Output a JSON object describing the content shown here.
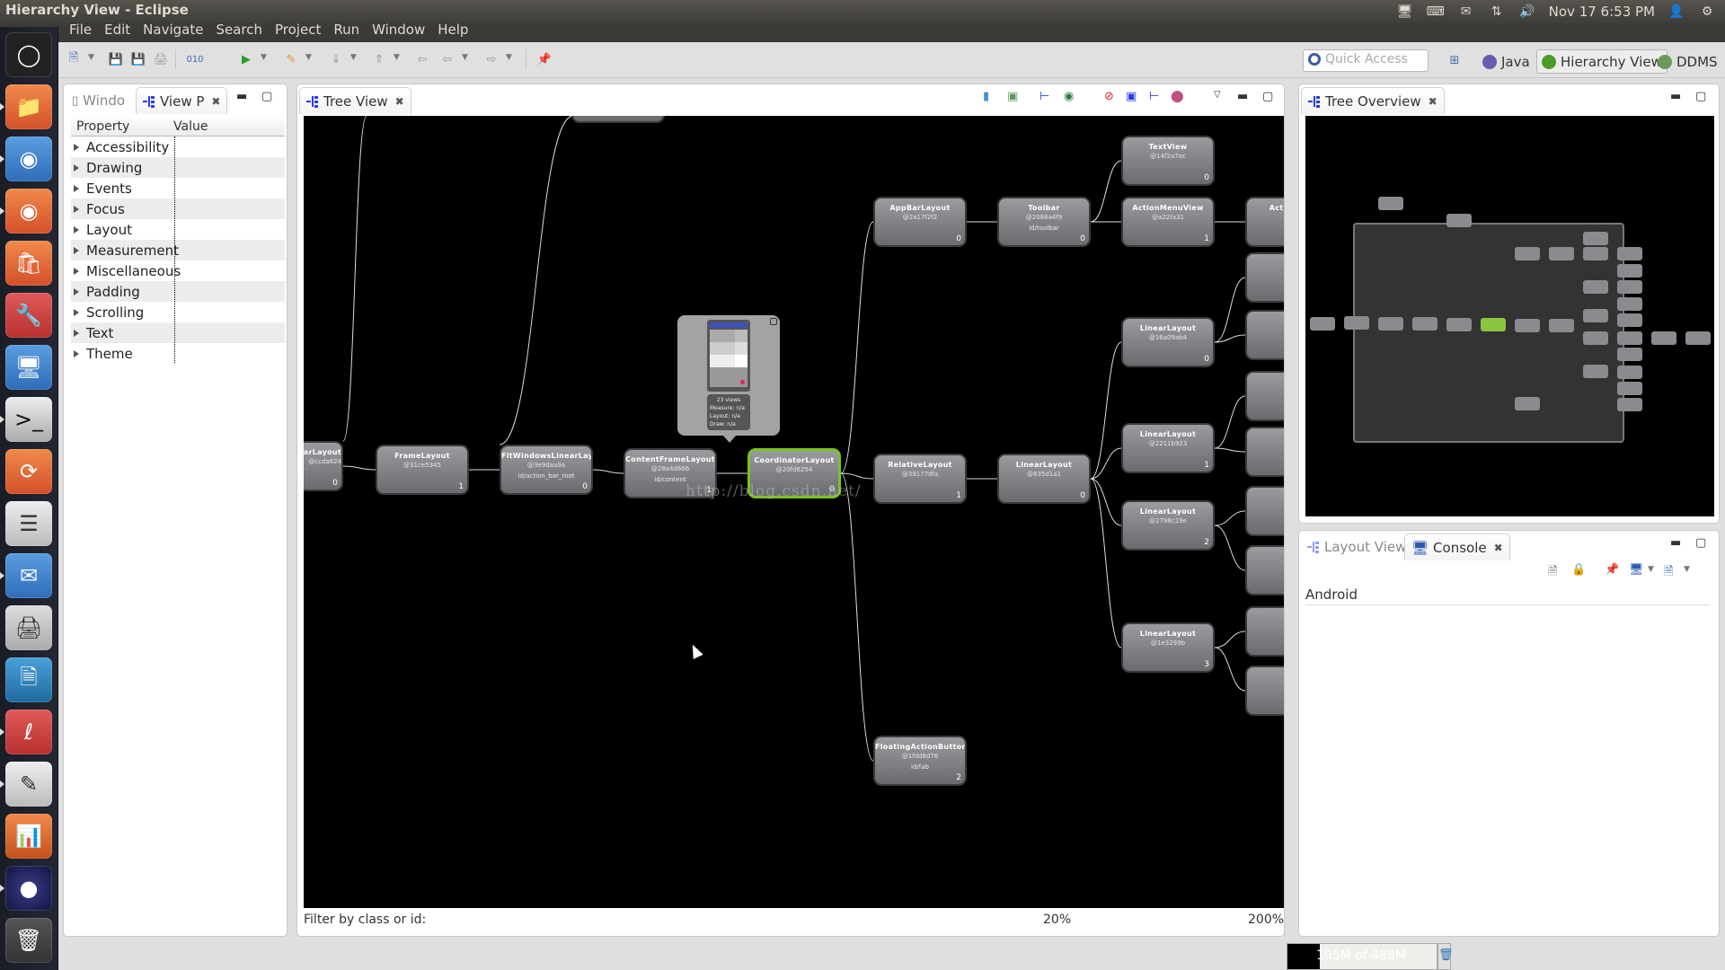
{
  "window": {
    "title": "Hierarchy View - Eclipse"
  },
  "menu": [
    "File",
    "Edit",
    "Navigate",
    "Search",
    "Project",
    "Run",
    "Window",
    "Help"
  ],
  "indicators": {
    "datetime": "Nov 17  6:53 PM",
    "icons": [
      "network-icon",
      "keyboard-icon",
      "mail-icon",
      "transfer-icon",
      "volume-icon",
      "user-icon",
      "power-icon"
    ]
  },
  "launcher": [
    "ubuntu-dash",
    "files",
    "chromium",
    "firefox",
    "software-center",
    "system-settings",
    "remote-desktop",
    "terminal",
    "meld",
    "disks",
    "thunderbird",
    "scanner",
    "libreoffice-writer",
    "evince",
    "text-editor",
    "libreoffice-impress",
    "eclipse",
    "trash"
  ],
  "toolbar": {
    "quick_access_placeholder": "Quick Access"
  },
  "perspectives": [
    {
      "label": "Java",
      "active": false
    },
    {
      "label": "Hierarchy View",
      "active": true
    },
    {
      "label": "DDMS",
      "active": false
    }
  ],
  "left_panel": {
    "tabs": [
      {
        "label": "Windo",
        "active": false
      },
      {
        "label": "View P",
        "active": true
      }
    ],
    "columns": [
      "Property",
      "Value"
    ],
    "properties": [
      "Accessibility",
      "Drawing",
      "Events",
      "Focus",
      "Layout",
      "Measurement",
      "Miscellaneous",
      "Padding",
      "Scrolling",
      "Text",
      "Theme"
    ]
  },
  "tree_view": {
    "tab_label": "Tree View",
    "filter_label": "Filter by class or id:",
    "zoom_min": "20%",
    "zoom_max": "200%",
    "watermark": "http://blog.csdn.net/",
    "popup": {
      "views": "23 views",
      "measure": "Measure: n/a",
      "layout": "Layout: n/a",
      "draw": "Draw: n/a"
    },
    "nodes": [
      {
        "cls": "earLayout",
        "hash": "@ccda824",
        "id": "",
        "idx": "0"
      },
      {
        "cls": "FrameLayout",
        "hash": "@31ce5345",
        "id": "",
        "idx": "1"
      },
      {
        "cls": "FitWindowsLinearLayout",
        "hash": "@3e9daa9a",
        "id": "id/action_bar_root",
        "idx": "0"
      },
      {
        "cls": "ContentFrameLayout",
        "hash": "@28a4d666",
        "id": "id/content",
        "idx": "1"
      },
      {
        "cls": "CoordinatorLayout",
        "hash": "@20fd6254",
        "id": "",
        "idx": "0",
        "selected": true
      },
      {
        "cls": "AppBarLayout",
        "hash": "@2a17f2f2",
        "id": "",
        "idx": "0"
      },
      {
        "cls": "Toolbar",
        "hash": "@2086a4f9",
        "id": "id/toolbar",
        "idx": "0"
      },
      {
        "cls": "TextView",
        "hash": "@14f2a7ec",
        "id": "",
        "idx": "0"
      },
      {
        "cls": "ActionMenuView",
        "hash": "@a22fa31",
        "id": "",
        "idx": "1"
      },
      {
        "cls": "RelativeLayout",
        "hash": "@39177dfa",
        "id": "",
        "idx": "1"
      },
      {
        "cls": "LinearLayout",
        "hash": "@835d1a1",
        "id": "",
        "idx": "0"
      },
      {
        "cls": "LinearLayout",
        "hash": "@16a09ab4",
        "id": "",
        "idx": "0"
      },
      {
        "cls": "LinearLayout",
        "hash": "@2211b923",
        "id": "",
        "idx": "1"
      },
      {
        "cls": "LinearLayout",
        "hash": "@2798c19e",
        "id": "",
        "idx": "2"
      },
      {
        "cls": "LinearLayout",
        "hash": "@1e3299b",
        "id": "",
        "idx": "3"
      },
      {
        "cls": "FloatingActionButton",
        "hash": "@1fdd8d76",
        "id": "id/fab",
        "idx": "2"
      },
      {
        "cls": "ActionMen",
        "hash": "",
        "id": "",
        "idx": ""
      }
    ]
  },
  "tree_overview": {
    "tab_label": "Tree Overview"
  },
  "bottom_right": {
    "tabs": [
      {
        "label": "Layout View",
        "active": false
      },
      {
        "label": "Console",
        "active": true
      }
    ],
    "console_header": "Android"
  },
  "status": {
    "memory": "105M of 488M",
    "memory_used_fraction": 0.215
  },
  "colors": {
    "selected_node_border": "#7ac41e",
    "canvas_bg": "#000000",
    "node_fill": "#808184"
  }
}
